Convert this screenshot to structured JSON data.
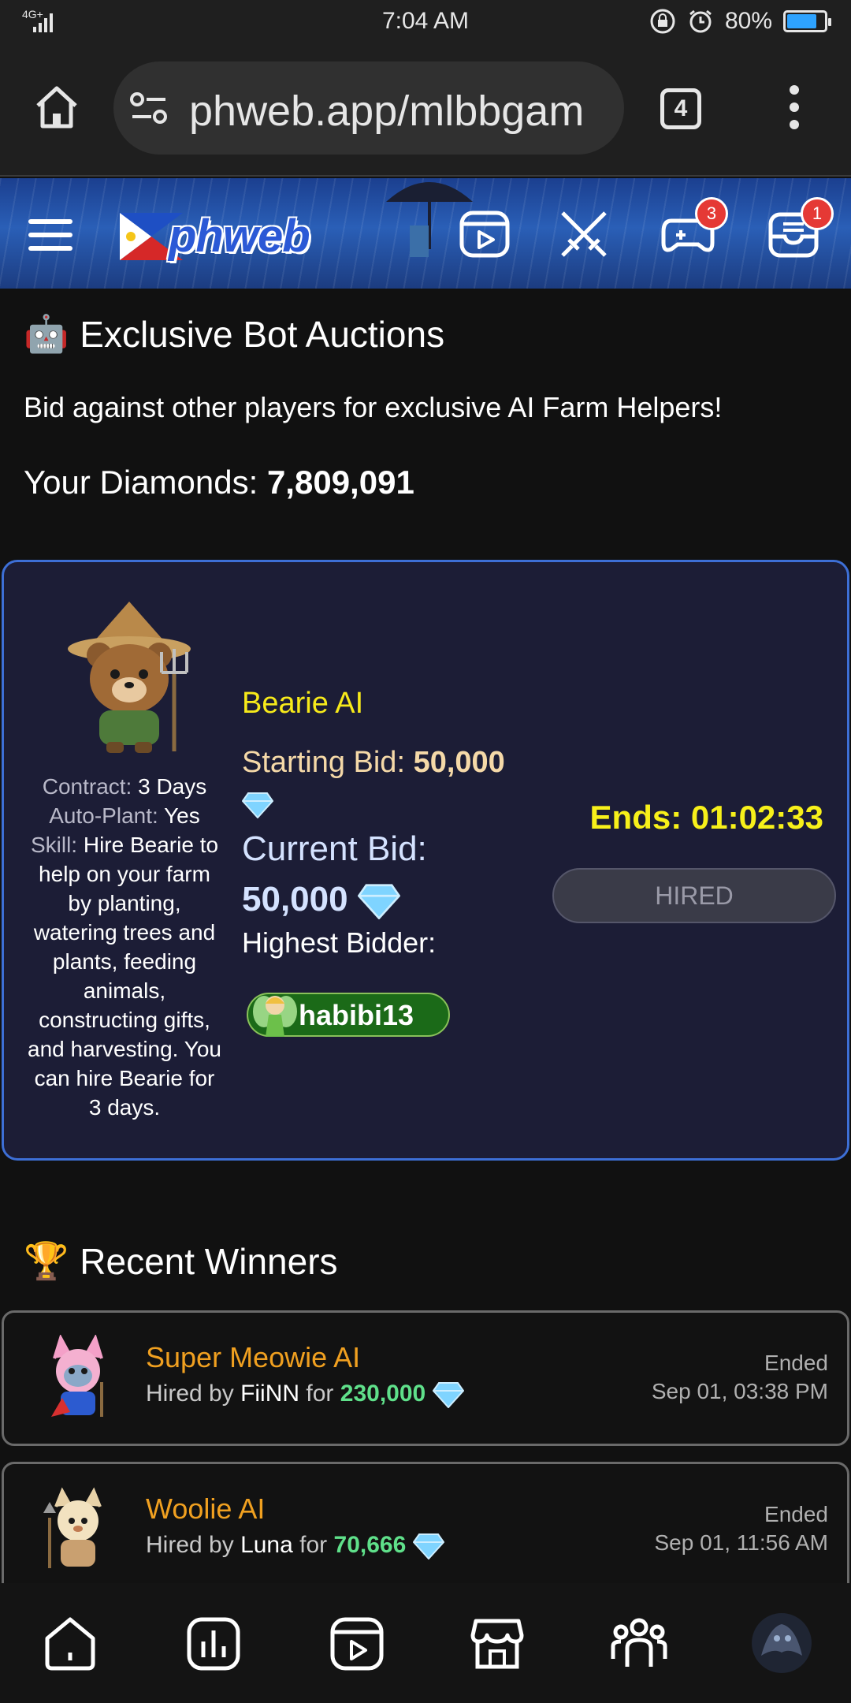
{
  "status_bar": {
    "network": "4G+",
    "time": "7:04 AM",
    "battery": "80%",
    "battery_level": 0.8
  },
  "browser": {
    "url": "phweb.app/mlbbgam",
    "tab_count": "4"
  },
  "site_header": {
    "logo_text": "phweb",
    "badges": {
      "games": "3",
      "inbox": "1"
    }
  },
  "auction_section": {
    "title_emoji": "🤖",
    "title": "Exclusive Bot Auctions",
    "subtitle": "Bid against other players for exclusive AI Farm Helpers!",
    "diamonds_label": "Your Diamonds:",
    "diamonds_value": "7,809,091"
  },
  "auction": {
    "contract_label": "Contract:",
    "contract_value": "3 Days",
    "autoplant_label": "Auto-Plant:",
    "autoplant_value": "Yes",
    "skill_label": "Skill:",
    "skill_value": "Hire Bearie to help on your farm by planting, watering trees and plants, feeding animals, constructing gifts, and harvesting. You can hire Bearie for 3 days.",
    "bot_name": "Bearie AI",
    "starting_bid_label": "Starting Bid:",
    "starting_bid_value": "50,000",
    "current_bid_label": "Current Bid:",
    "current_bid_value": "50,000",
    "highest_bidder_label": "Highest Bidder:",
    "highest_bidder": "habibi13",
    "ends": "Ends: 01:02:33",
    "button_label": "HIRED"
  },
  "winners_section": {
    "title_emoji": "🏆",
    "title": "Recent Winners",
    "items": [
      {
        "name": "Super Meowie AI",
        "hired_by_label": "Hired by",
        "user": "FiiNN",
        "for_label": "for",
        "amount": "230,000",
        "status": "Ended",
        "date": "Sep 01, 03:38 PM"
      },
      {
        "name": "Woolie AI",
        "hired_by_label": "Hired by",
        "user": "Luna",
        "for_label": "for",
        "amount": "70,666",
        "status": "Ended",
        "date": "Sep 01, 11:56 AM"
      }
    ]
  },
  "colors": {
    "accent_yellow": "#f7ea1a",
    "card_bg": "#1c1d36",
    "card_border": "#3d6fd6",
    "winner_name": "#f0a020",
    "amount_green": "#5fe08a"
  }
}
